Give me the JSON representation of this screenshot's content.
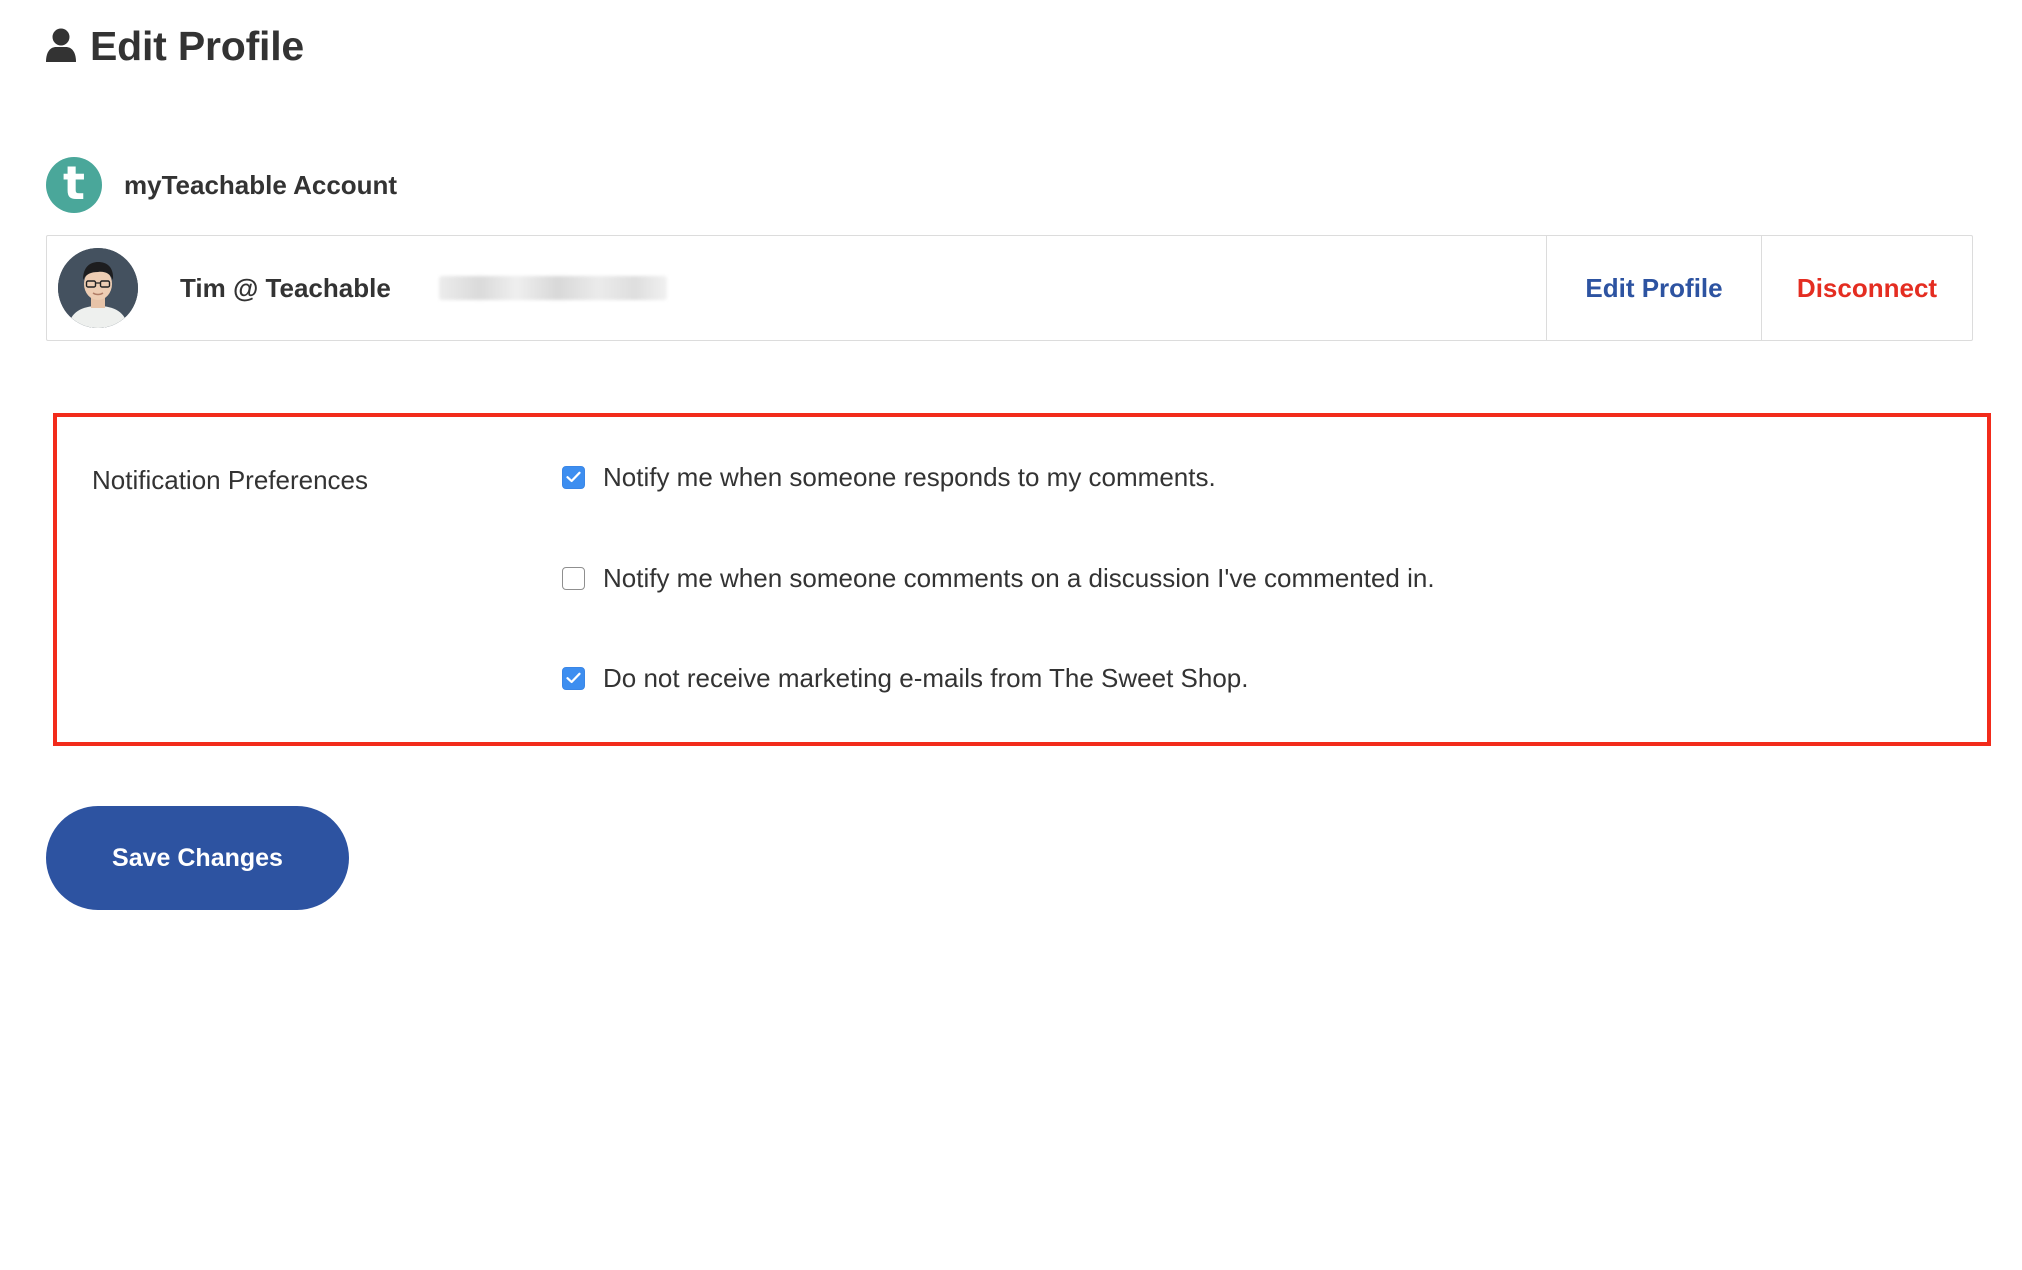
{
  "page": {
    "title": "Edit Profile",
    "icon": "user-icon"
  },
  "account": {
    "title": "myTeachable Account",
    "logo_letter": "t",
    "logo_color": "#4aa79a",
    "user_name": "Tim @ Teachable",
    "email_redacted": true,
    "edit_label": "Edit Profile",
    "disconnect_label": "Disconnect"
  },
  "notifications": {
    "label": "Notification Preferences",
    "options": [
      {
        "label": "Notify me when someone responds to my comments.",
        "checked": true
      },
      {
        "label": "Notify me when someone comments on a discussion I've commented in.",
        "checked": false
      },
      {
        "label": "Do not receive marketing e-mails from The Sweet Shop.",
        "checked": true
      }
    ],
    "highlight_color": "#f22b1b"
  },
  "actions": {
    "save_label": "Save Changes"
  },
  "colors": {
    "primary": "#2d53a1",
    "danger": "#e42d21",
    "checkbox": "#3d8ef0",
    "text": "#333333"
  }
}
